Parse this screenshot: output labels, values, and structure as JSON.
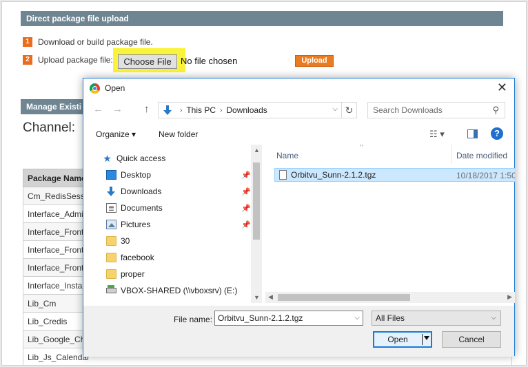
{
  "background": {
    "section_upload": "Direct package file upload",
    "step1_num": "1",
    "step1_text": "Download or build package file.",
    "step2_num": "2",
    "step2_text": "Upload package file:",
    "choose_file_label": "Choose File",
    "no_file_text": "No file chosen",
    "upload_label": "Upload",
    "section_manage": "Manage Existi",
    "channel_label": "Channel:",
    "table_header": "Package Name",
    "packages": [
      "Cm_RedisSess",
      "Interface_Admir",
      "Interface_Fronte",
      "Interface_Fronte",
      "Interface_Fronte",
      "Interface_Instal",
      "Lib_Cm",
      "Lib_Credis",
      "Lib_Google_Ch",
      "Lib_Js_Calendar"
    ]
  },
  "dialog": {
    "title": "Open",
    "close_glyph": "✕",
    "nav_back": "←",
    "nav_forward": "→",
    "nav_up": "↑",
    "address": {
      "segments": [
        "This PC",
        "Downloads"
      ]
    },
    "search_placeholder": "Search Downloads",
    "toolbar": {
      "organize": "Organize ▾",
      "new_folder": "New folder",
      "help": "?"
    },
    "nav_items": [
      {
        "label": "Quick access",
        "icon": "star-icon"
      },
      {
        "label": "Desktop",
        "icon": "desktop-icon",
        "pinned": true
      },
      {
        "label": "Downloads",
        "icon": "download-icon",
        "pinned": true
      },
      {
        "label": "Documents",
        "icon": "documents-icon",
        "pinned": true
      },
      {
        "label": "Pictures",
        "icon": "pictures-icon",
        "pinned": true
      },
      {
        "label": "30",
        "icon": "folder-icon"
      },
      {
        "label": "facebook",
        "icon": "folder-icon"
      },
      {
        "label": "proper",
        "icon": "folder-icon"
      },
      {
        "label": "VBOX-SHARED (\\\\vboxsrv) (E:)",
        "icon": "network-drive-icon"
      }
    ],
    "columns": {
      "name": "Name",
      "date": "Date modified"
    },
    "files": [
      {
        "name": "Orbitvu_Sunn-2.1.2.tgz",
        "date": "10/18/2017 1:50"
      }
    ],
    "file_name_label": "File name:",
    "file_name_value": "Orbitvu_Sunn-2.1.2.tgz",
    "file_type": "All Files",
    "open_label": "Open",
    "cancel_label": "Cancel"
  },
  "colors": {
    "section_header": "#6f8592",
    "accent_orange": "#eb6b1f",
    "highlight_yellow": "#f9f33c",
    "dialog_border": "#1a7bd4",
    "selection": "#cce8ff"
  }
}
